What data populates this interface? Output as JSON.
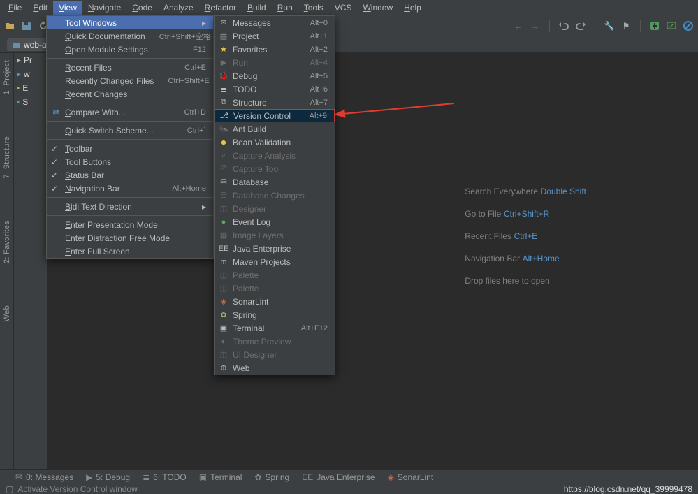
{
  "menubar": [
    "File",
    "Edit",
    "View",
    "Navigate",
    "Code",
    "Analyze",
    "Refactor",
    "Build",
    "Run",
    "Tools",
    "VCS",
    "Window",
    "Help"
  ],
  "menubar_active_index": 2,
  "menubar_mnemonic": [
    "F",
    "E",
    "V",
    "N",
    "C",
    null,
    "R",
    "B",
    "R",
    "T",
    null,
    "W",
    "H"
  ],
  "breadcrumb": {
    "chip": "web-ap"
  },
  "project_rows": [
    "Pr",
    "w",
    "E",
    "S"
  ],
  "left_tabs": [
    "1: Project",
    "7: Structure",
    "2: Favorites",
    "Web"
  ],
  "view_menu": [
    {
      "label": "Tool Windows",
      "type": "highlight",
      "arrow": true
    },
    {
      "label": "Quick Documentation",
      "shortcut": "Ctrl+Shift+空格"
    },
    {
      "label": "Open Module Settings",
      "shortcut": "F12"
    },
    {
      "type": "sep"
    },
    {
      "label": "Recent Files",
      "shortcut": "Ctrl+E"
    },
    {
      "label": "Recently Changed Files",
      "shortcut": "Ctrl+Shift+E"
    },
    {
      "label": "Recent Changes"
    },
    {
      "type": "sep"
    },
    {
      "label": "Compare With...",
      "shortcut": "Ctrl+D",
      "icon": "compare"
    },
    {
      "type": "sep"
    },
    {
      "label": "Quick Switch Scheme...",
      "shortcut": "Ctrl+`"
    },
    {
      "type": "sep"
    },
    {
      "label": "Toolbar",
      "check": true
    },
    {
      "label": "Tool Buttons",
      "check": true
    },
    {
      "label": "Status Bar",
      "check": true
    },
    {
      "label": "Navigation Bar",
      "check": true,
      "shortcut": "Alt+Home"
    },
    {
      "type": "sep"
    },
    {
      "label": "Bidi Text Direction",
      "arrow": true
    },
    {
      "type": "sep"
    },
    {
      "label": "Enter Presentation Mode"
    },
    {
      "label": "Enter Distraction Free Mode"
    },
    {
      "label": "Enter Full Screen"
    }
  ],
  "tool_windows": [
    {
      "label": "Messages",
      "shortcut": "Alt+0",
      "icon": "✉",
      "c": "#bbb"
    },
    {
      "label": "Project",
      "shortcut": "Alt+1",
      "icon": "▤",
      "c": "#bbb"
    },
    {
      "label": "Favorites",
      "shortcut": "Alt+2",
      "icon": "★",
      "c": "#e8c14b"
    },
    {
      "label": "Run",
      "shortcut": "Alt+4",
      "icon": "▶",
      "dis": true,
      "c": "#6e6e6e"
    },
    {
      "label": "Debug",
      "shortcut": "Alt+5",
      "icon": "🐞",
      "c": "#8fb573"
    },
    {
      "label": "TODO",
      "shortcut": "Alt+6",
      "icon": "≣",
      "c": "#bbb"
    },
    {
      "label": "Structure",
      "shortcut": "Alt+7",
      "icon": "⧉",
      "c": "#bbb"
    },
    {
      "label": "Version Control",
      "shortcut": "Alt+9",
      "icon": "⎇",
      "sel": true,
      "c": "#bbb"
    },
    {
      "label": "Ant Build",
      "icon": "🐜",
      "c": "#bbb"
    },
    {
      "label": "Bean Validation",
      "icon": "◆",
      "c": "#e8c14b"
    },
    {
      "label": "Capture Analysis",
      "dis": true,
      "icon": "⌕",
      "c": "#6e6e6e"
    },
    {
      "label": "Capture Tool",
      "dis": true,
      "icon": "⎚",
      "c": "#6e6e6e"
    },
    {
      "label": "Database",
      "icon": "⛁",
      "c": "#bbb"
    },
    {
      "label": "Database Changes",
      "dis": true,
      "icon": "⛁",
      "c": "#6e6e6e"
    },
    {
      "label": "Designer",
      "dis": true,
      "icon": "◫",
      "c": "#6e6e6e"
    },
    {
      "label": "Event Log",
      "icon": "●",
      "c": "#5da85d"
    },
    {
      "label": "Image Layers",
      "dis": true,
      "icon": "▦",
      "c": "#6e6e6e"
    },
    {
      "label": "Java Enterprise",
      "icon": "EE",
      "c": "#bbb"
    },
    {
      "label": "Maven Projects",
      "icon": "m",
      "c": "#bbb"
    },
    {
      "label": "Palette",
      "dis": true,
      "icon": "◫",
      "c": "#6e6e6e"
    },
    {
      "label": "Palette",
      "dis": true,
      "icon": "◫",
      "c": "#6e6e6e"
    },
    {
      "label": "SonarLint",
      "icon": "◈",
      "c": "#cc6b4a"
    },
    {
      "label": "Spring",
      "icon": "✿",
      "c": "#8fb573"
    },
    {
      "label": "Terminal",
      "shortcut": "Alt+F12",
      "icon": "▣",
      "c": "#bbb"
    },
    {
      "label": "Theme Preview",
      "dis": true,
      "icon": "◐",
      "c": "#6e6e6e"
    },
    {
      "label": "UI Designer",
      "dis": true,
      "icon": "◫",
      "c": "#6e6e6e"
    },
    {
      "label": "Web",
      "icon": "⊕",
      "c": "#bbb"
    }
  ],
  "tips": [
    {
      "t": "Search Everywhere",
      "k": "Double Shift"
    },
    {
      "t": "Go to File",
      "k": "Ctrl+Shift+R"
    },
    {
      "t": "Recent Files",
      "k": "Ctrl+E"
    },
    {
      "t": "Navigation Bar",
      "k": "Alt+Home"
    },
    {
      "t": "Drop files here to open",
      "k": ""
    }
  ],
  "bottom": [
    {
      "icon": "✉",
      "label": "0: Messages",
      "u": "0"
    },
    {
      "icon": "▶",
      "label": "5: Debug",
      "u": "5"
    },
    {
      "icon": "≣",
      "label": "6: TODO",
      "u": "6"
    },
    {
      "icon": "▣",
      "label": "Terminal"
    },
    {
      "icon": "✿",
      "label": "Spring"
    },
    {
      "icon": "EE",
      "label": "Java Enterprise"
    },
    {
      "icon": "◈",
      "label": "SonarLint",
      "c": "#cc6b4a"
    }
  ],
  "status": {
    "left": "Activate Version Control window",
    "right": "https://blog.csdn.net/qq_39999478"
  }
}
